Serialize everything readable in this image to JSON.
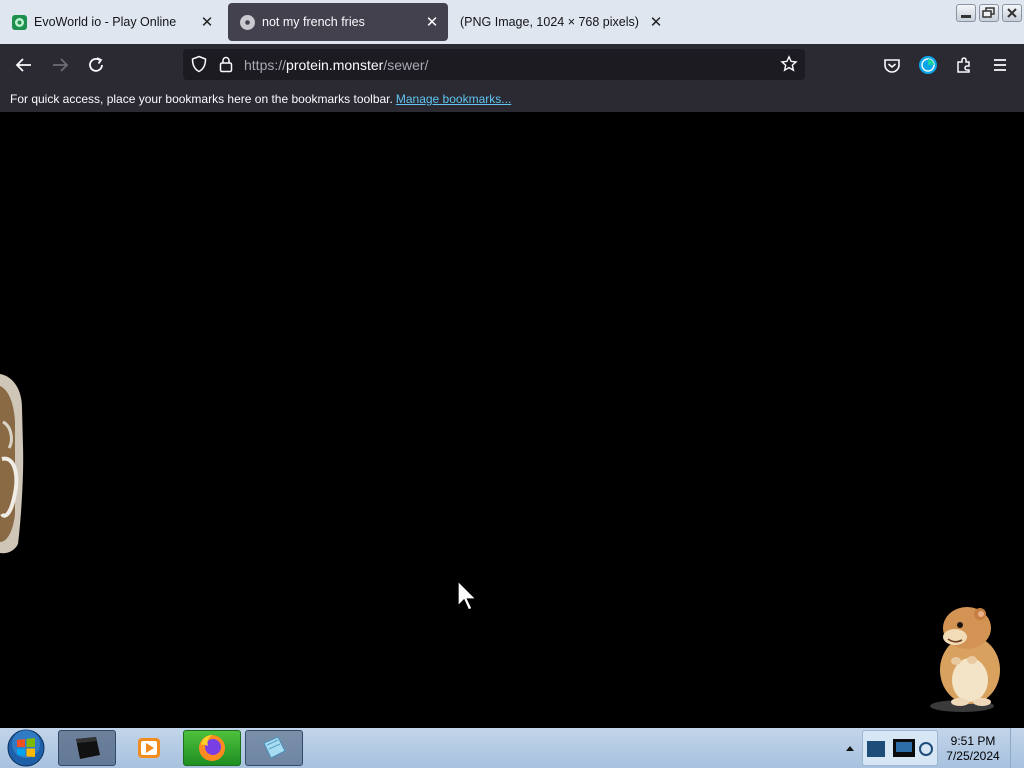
{
  "browser": {
    "tabs": [
      {
        "title": "EvoWorld io - Play Online",
        "icon": "evoworld-favicon",
        "active": false
      },
      {
        "title": "not my french fries",
        "icon": "disc-favicon",
        "active": true
      },
      {
        "title": "(PNG Image, 1024 × 768 pixels)",
        "icon": "none",
        "active": false
      }
    ],
    "close_glyph": "✕",
    "url": {
      "scheme": "https://",
      "host": "protein.monster",
      "path": "/sewer/"
    },
    "bookmarks_bar": {
      "message": "For quick access, place your bookmarks here on the bookmarks toolbar.",
      "link": "Manage bookmarks..."
    },
    "colors": {
      "tabstrip": "#dfe6ef",
      "active_tab": "#42414d",
      "toolbar": "#2b2a33",
      "urlbar": "#1c1b22",
      "link": "#5fc4f0",
      "page": "#000000"
    }
  },
  "page": {
    "sprites": [
      "jar-sprite",
      "hamster-sprite"
    ]
  },
  "taskbar": {
    "pinned": [
      "media-player-icon",
      "media-center-icon",
      "firefox-icon",
      "notepad-icon"
    ],
    "clock": {
      "time": "9:51 PM",
      "date": "7/25/2024"
    }
  }
}
